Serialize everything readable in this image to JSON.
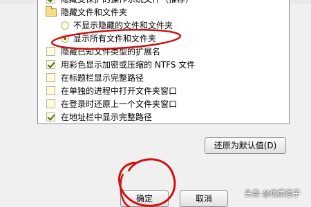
{
  "list": {
    "rows": [
      {
        "kind": "checkbox",
        "checked": true,
        "label": "隐藏受保护的操作系统文件（推荐）"
      },
      {
        "kind": "folder",
        "label": "隐藏文件和文件夹"
      },
      {
        "kind": "radio",
        "selected": false,
        "label": "不显示隐藏的文件和文件夹"
      },
      {
        "kind": "radio",
        "selected": true,
        "label": "显示所有文件和文件夹"
      },
      {
        "kind": "checkbox",
        "checked": false,
        "label": "隐藏已知文件类型的扩展名"
      },
      {
        "kind": "checkbox",
        "checked": true,
        "label": "用彩色显示加密或压缩的 NTFS 文件"
      },
      {
        "kind": "checkbox",
        "checked": false,
        "label": "在标题栏显示完整路径"
      },
      {
        "kind": "checkbox",
        "checked": false,
        "label": "在单独的进程中打开文件夹窗口"
      },
      {
        "kind": "checkbox",
        "checked": false,
        "label": "在登录时还原上一个文件夹窗口"
      },
      {
        "kind": "checkbox",
        "checked": true,
        "label": "在地址栏中显示完整路径"
      }
    ]
  },
  "restore_defaults_label": "还原为默认值(D)",
  "ok_label": "确定",
  "cancel_label": "取消",
  "watermark_text": "头条 @优质混子",
  "colors": {
    "annotation_red": "#d01010",
    "checkmark": "#3b6a1b",
    "radio_dot": "#2a8a1a"
  }
}
